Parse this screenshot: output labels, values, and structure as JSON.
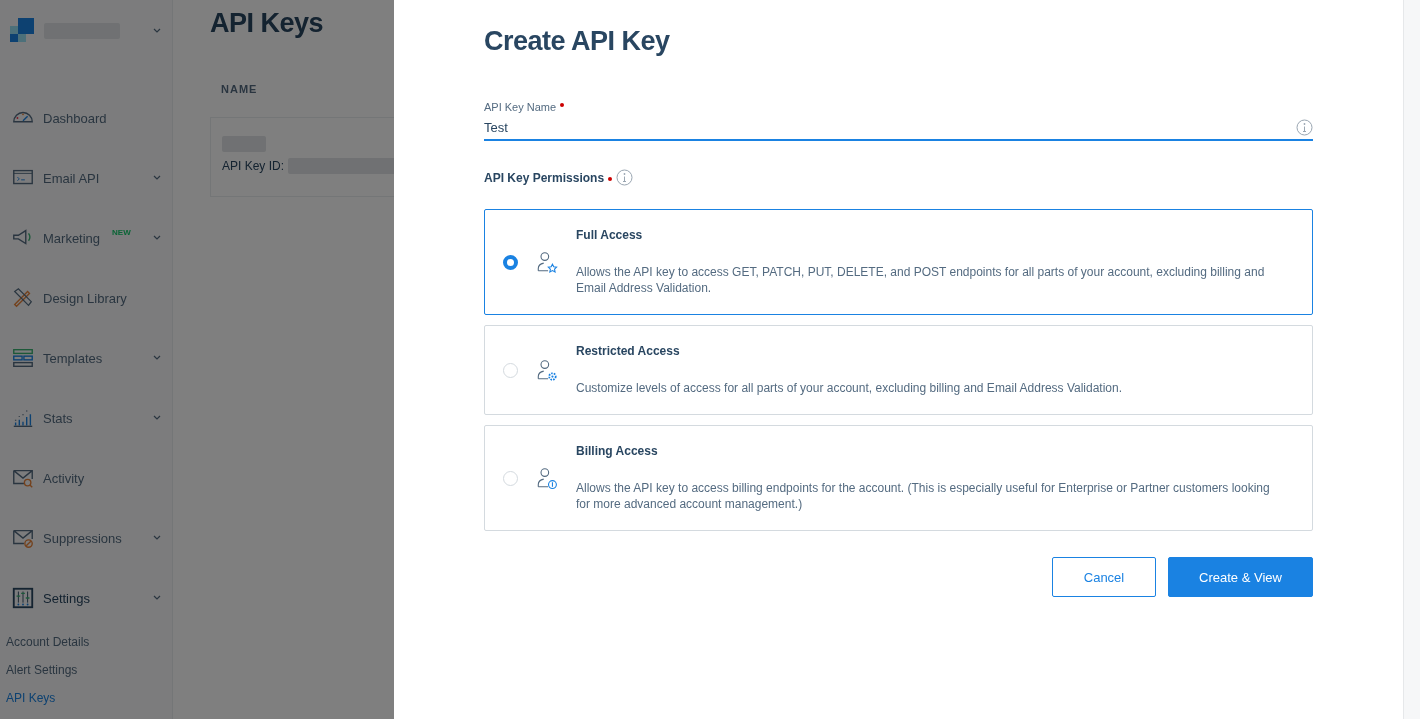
{
  "sidebar": {
    "items": [
      {
        "label": "Dashboard",
        "expandable": false,
        "selected": false
      },
      {
        "label": "Email API",
        "expandable": true,
        "selected": false
      },
      {
        "label": "Marketing",
        "badge": "NEW",
        "expandable": true,
        "selected": false
      },
      {
        "label": "Design Library",
        "expandable": false,
        "selected": false
      },
      {
        "label": "Templates",
        "expandable": true,
        "selected": false
      },
      {
        "label": "Stats",
        "expandable": true,
        "selected": false
      },
      {
        "label": "Activity",
        "expandable": false,
        "selected": false
      },
      {
        "label": "Suppressions",
        "expandable": true,
        "selected": false
      },
      {
        "label": "Settings",
        "expandable": true,
        "selected": true,
        "children": [
          {
            "label": "Account Details",
            "selected": false
          },
          {
            "label": "Alert Settings",
            "selected": false
          },
          {
            "label": "API Keys",
            "selected": true
          }
        ]
      }
    ]
  },
  "page": {
    "title": "API Keys",
    "table": {
      "columns": [
        "NAME"
      ],
      "rows": [
        {
          "id_label": "API Key ID:"
        }
      ]
    }
  },
  "modal": {
    "title": "Create API Key",
    "name_field": {
      "label": "API Key Name",
      "required": true,
      "value": "Test"
    },
    "permissions": {
      "label": "API Key Permissions",
      "required": true,
      "options": [
        {
          "kind": "full",
          "title": "Full Access",
          "description": "Allows the API key to access GET, PATCH, PUT, DELETE, and POST endpoints for all parts of your account, excluding billing and Email Address Validation.",
          "selected": true
        },
        {
          "kind": "restricted",
          "title": "Restricted Access",
          "description": "Customize levels of access for all parts of your account, excluding billing and Email Address Validation.",
          "selected": false
        },
        {
          "kind": "billing",
          "title": "Billing Access",
          "description": "Allows the API key to access billing endpoints for the account. (This is especially useful for Enterprise or Partner customers looking for more advanced account management.)",
          "selected": false
        }
      ]
    },
    "buttons": [
      {
        "label": "Cancel",
        "kind": "secondary"
      },
      {
        "label": "Create & View",
        "kind": "primary"
      }
    ]
  }
}
